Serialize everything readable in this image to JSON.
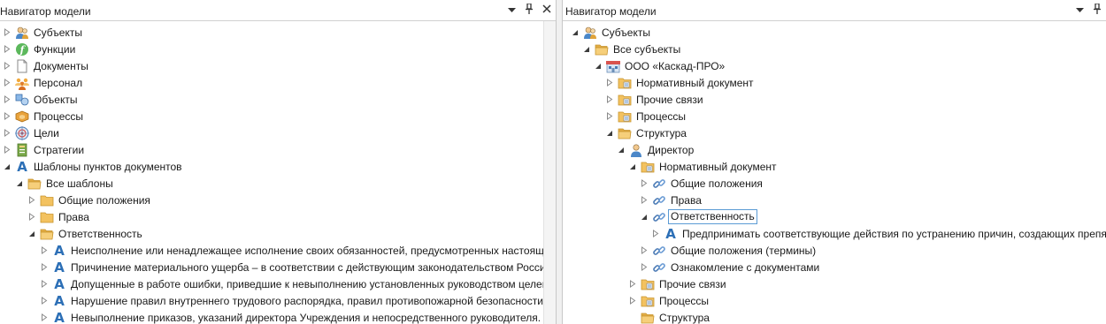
{
  "colors": {
    "accent": "#2c6fb6",
    "folder": "#e9b24a",
    "selection_border": "#5b9bd5"
  },
  "left": {
    "title": "Навигатор модели",
    "toolbar_icons": [
      "chevron-down-icon",
      "pin-icon",
      "close-icon"
    ],
    "items": [
      {
        "label": "Субъекты",
        "icon": "people-icon",
        "state": "collapsed",
        "level": 0
      },
      {
        "label": "Функции",
        "icon": "function-icon",
        "state": "collapsed",
        "level": 0
      },
      {
        "label": "Документы",
        "icon": "document-icon",
        "state": "collapsed",
        "level": 0
      },
      {
        "label": "Персонал",
        "icon": "group-icon",
        "state": "collapsed",
        "level": 0
      },
      {
        "label": "Объекты",
        "icon": "objects-icon",
        "state": "collapsed",
        "level": 0
      },
      {
        "label": "Процессы",
        "icon": "process-icon",
        "state": "collapsed",
        "level": 0
      },
      {
        "label": "Цели",
        "icon": "target-icon",
        "state": "collapsed",
        "level": 0
      },
      {
        "label": "Стратегии",
        "icon": "strategy-icon",
        "state": "collapsed",
        "level": 0
      },
      {
        "label": "Шаблоны пунктов документов",
        "icon": "letter-a-icon",
        "state": "expanded",
        "level": 0
      },
      {
        "label": "Все шаблоны",
        "icon": "folder-open-icon",
        "state": "expanded",
        "level": 1
      },
      {
        "label": "Общие положения",
        "icon": "folder-icon",
        "state": "collapsed",
        "level": 2
      },
      {
        "label": "Права",
        "icon": "folder-icon",
        "state": "collapsed",
        "level": 2
      },
      {
        "label": "Ответственность",
        "icon": "folder-open-icon",
        "state": "expanded",
        "level": 2
      },
      {
        "label": "Неисполнение или ненадлежащее исполнение своих обязанностей, предусмотренных настоящей",
        "icon": "letter-a-icon",
        "state": "collapsed",
        "level": 3
      },
      {
        "label": "Причинение материального ущерба – в соответствии с действующим законодательством России",
        "icon": "letter-a-icon",
        "state": "collapsed",
        "level": 3
      },
      {
        "label": "Допущенные в работе ошибки, приведшие к невыполнению установленных руководством целей",
        "icon": "letter-a-icon",
        "state": "collapsed",
        "level": 3
      },
      {
        "label": "Нарушение правил внутреннего трудового распорядка, правил противопожарной безопасности",
        "icon": "letter-a-icon",
        "state": "collapsed",
        "level": 3
      },
      {
        "label": "Невыполнение приказов, указаний директора Учреждения и непосредственного руководителя.",
        "icon": "letter-a-icon",
        "state": "collapsed",
        "level": 3
      }
    ]
  },
  "right": {
    "title": "Навигатор модели",
    "toolbar_icons": [
      "chevron-down-icon",
      "pin-icon"
    ],
    "items": [
      {
        "label": "Субъекты",
        "icon": "people-icon",
        "state": "expanded",
        "level": 0
      },
      {
        "label": "Все субъекты",
        "icon": "folder-open-icon",
        "state": "expanded",
        "level": 1
      },
      {
        "label": "ООО «Каскад-ПРО»",
        "icon": "organization-icon",
        "state": "expanded",
        "level": 2
      },
      {
        "label": "Нормативный документ",
        "icon": "folder-doc-icon",
        "state": "collapsed",
        "level": 3
      },
      {
        "label": "Прочие связи",
        "icon": "folder-doc-icon",
        "state": "collapsed",
        "level": 3
      },
      {
        "label": "Процессы",
        "icon": "folder-doc-icon",
        "state": "collapsed",
        "level": 3
      },
      {
        "label": "Структура",
        "icon": "folder-open-icon",
        "state": "expanded",
        "level": 3
      },
      {
        "label": "Директор",
        "icon": "person-icon",
        "state": "expanded",
        "level": 4
      },
      {
        "label": "Нормативный документ",
        "icon": "folder-doc-icon",
        "state": "expanded",
        "level": 5
      },
      {
        "label": "Общие положения",
        "icon": "link-icon",
        "state": "collapsed",
        "level": 6
      },
      {
        "label": "Права",
        "icon": "link-icon",
        "state": "collapsed",
        "level": 6
      },
      {
        "label": "Ответственность",
        "icon": "link-icon",
        "state": "expanded",
        "level": 6,
        "selected": true
      },
      {
        "label": "Предпринимать соответствующие действия по устранению причин, создающих препя",
        "icon": "letter-a-icon",
        "state": "collapsed",
        "level": 7
      },
      {
        "label": "Общие положения (термины)",
        "icon": "link-icon",
        "state": "collapsed",
        "level": 6
      },
      {
        "label": "Ознакомление с документами",
        "icon": "link-icon",
        "state": "collapsed",
        "level": 6
      },
      {
        "label": "Прочие связи",
        "icon": "folder-doc-icon",
        "state": "collapsed",
        "level": 5
      },
      {
        "label": "Процессы",
        "icon": "folder-doc-icon",
        "state": "collapsed",
        "level": 5
      },
      {
        "label": "Структура",
        "icon": "folder-open-icon",
        "state": "none",
        "level": 5
      }
    ]
  }
}
